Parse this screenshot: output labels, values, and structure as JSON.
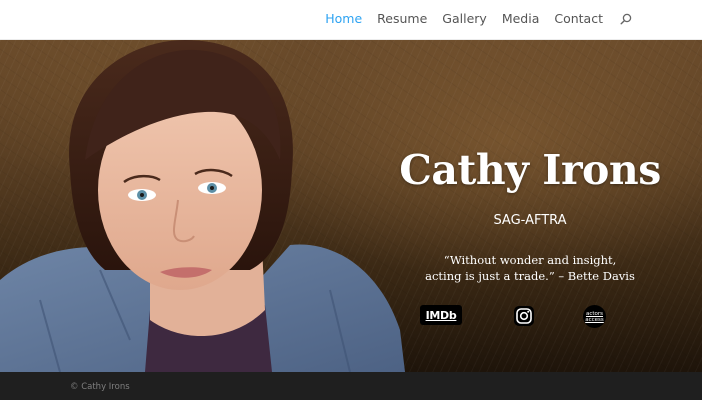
{
  "nav": {
    "items": [
      {
        "label": "Home",
        "active": true
      },
      {
        "label": "Resume",
        "active": false
      },
      {
        "label": "Gallery",
        "active": false
      },
      {
        "label": "Media",
        "active": false
      },
      {
        "label": "Contact",
        "active": false
      }
    ],
    "search_icon": "search-icon",
    "active_color": "#2ea3f2",
    "text_color": "#555555"
  },
  "hero": {
    "title": "Cathy Irons",
    "subtitle": "SAG-AFTRA",
    "quote_line1": "“Without wonder and insight,",
    "quote_line2": "acting is just a trade.”  – Bette Davis",
    "portrait": "headshot-photo"
  },
  "social": {
    "imdb_label": "IMDb",
    "instagram_icon": "instagram-icon",
    "actors_access_line1": "actors",
    "actors_access_line2": "access"
  },
  "footer": {
    "copyright": "© Cathy Irons",
    "background": "#1f1f1f"
  }
}
